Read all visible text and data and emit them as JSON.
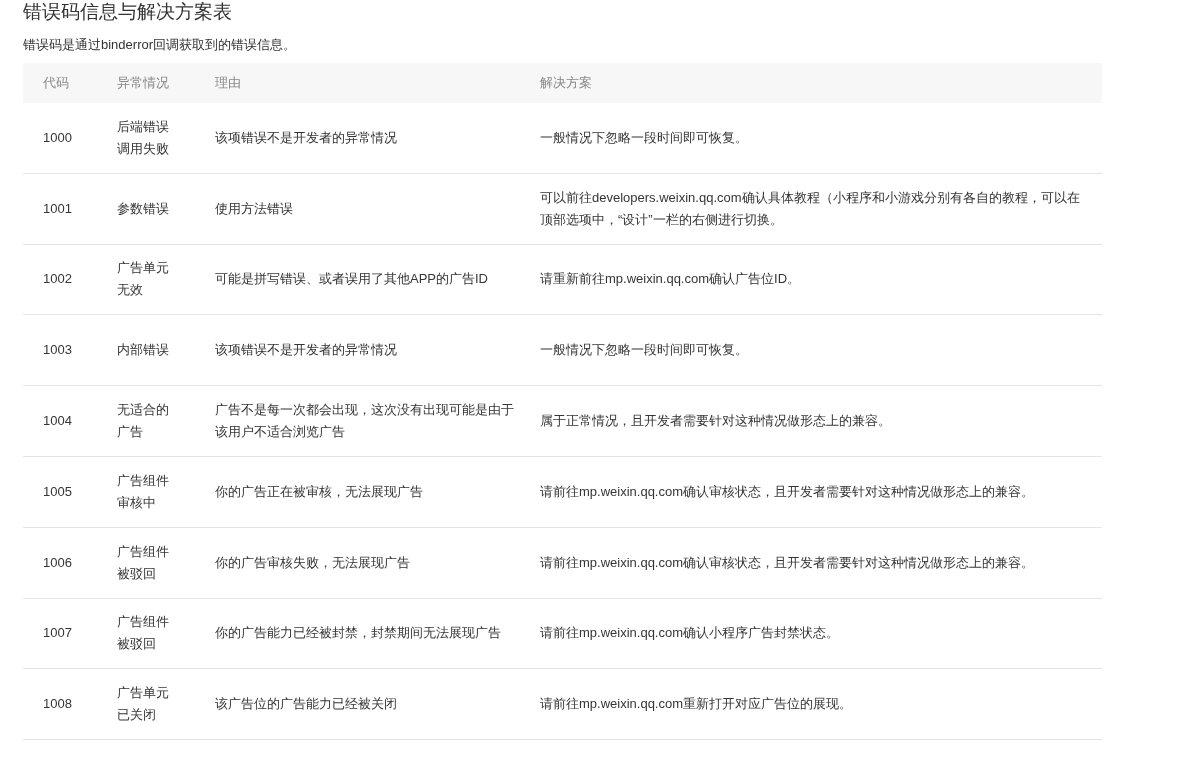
{
  "title": "错误码信息与解决方案表",
  "intro": "错误码是通过binderror回调获取到的错误信息。",
  "table": {
    "columns": [
      "代码",
      "异常情况",
      "理由",
      "解决方案"
    ],
    "rows": [
      {
        "code": "1000",
        "case": "后端错误调用失败",
        "reason": "该项错误不是开发者的异常情况",
        "solution": "一般情况下忽略一段时间即可恢复。"
      },
      {
        "code": "1001",
        "case": "参数错误",
        "reason": "使用方法错误",
        "solution": "可以前往developers.weixin.qq.com确认具体教程（小程序和小游戏分别有各自的教程，可以在顶部选项中，“设计”一栏的右侧进行切换。"
      },
      {
        "code": "1002",
        "case": "广告单元无效",
        "reason": "可能是拼写错误、或者误用了其他APP的广告ID",
        "solution": "请重新前往mp.weixin.qq.com确认广告位ID。"
      },
      {
        "code": "1003",
        "case": "内部错误",
        "reason": "该项错误不是开发者的异常情况",
        "solution": "一般情况下忽略一段时间即可恢复。"
      },
      {
        "code": "1004",
        "case": "无适合的广告",
        "reason": "广告不是每一次都会出现，这次没有出现可能是由于该用户不适合浏览广告",
        "solution": "属于正常情况，且开发者需要针对这种情况做形态上的兼容。"
      },
      {
        "code": "1005",
        "case": "广告组件审核中",
        "reason": "你的广告正在被审核，无法展现广告",
        "solution": "请前往mp.weixin.qq.com确认审核状态，且开发者需要针对这种情况做形态上的兼容。"
      },
      {
        "code": "1006",
        "case": "广告组件被驳回",
        "reason": "你的广告审核失败，无法展现广告",
        "solution": "请前往mp.weixin.qq.com确认审核状态，且开发者需要针对这种情况做形态上的兼容。"
      },
      {
        "code": "1007",
        "case": "广告组件被驳回",
        "reason": "你的广告能力已经被封禁，封禁期间无法展现广告",
        "solution": "请前往mp.weixin.qq.com确认小程序广告封禁状态。"
      },
      {
        "code": "1008",
        "case": "广告单元已关闭",
        "reason": "该广告位的广告能力已经被关闭",
        "solution": "请前往mp.weixin.qq.com重新打开对应广告位的展现。"
      }
    ]
  }
}
